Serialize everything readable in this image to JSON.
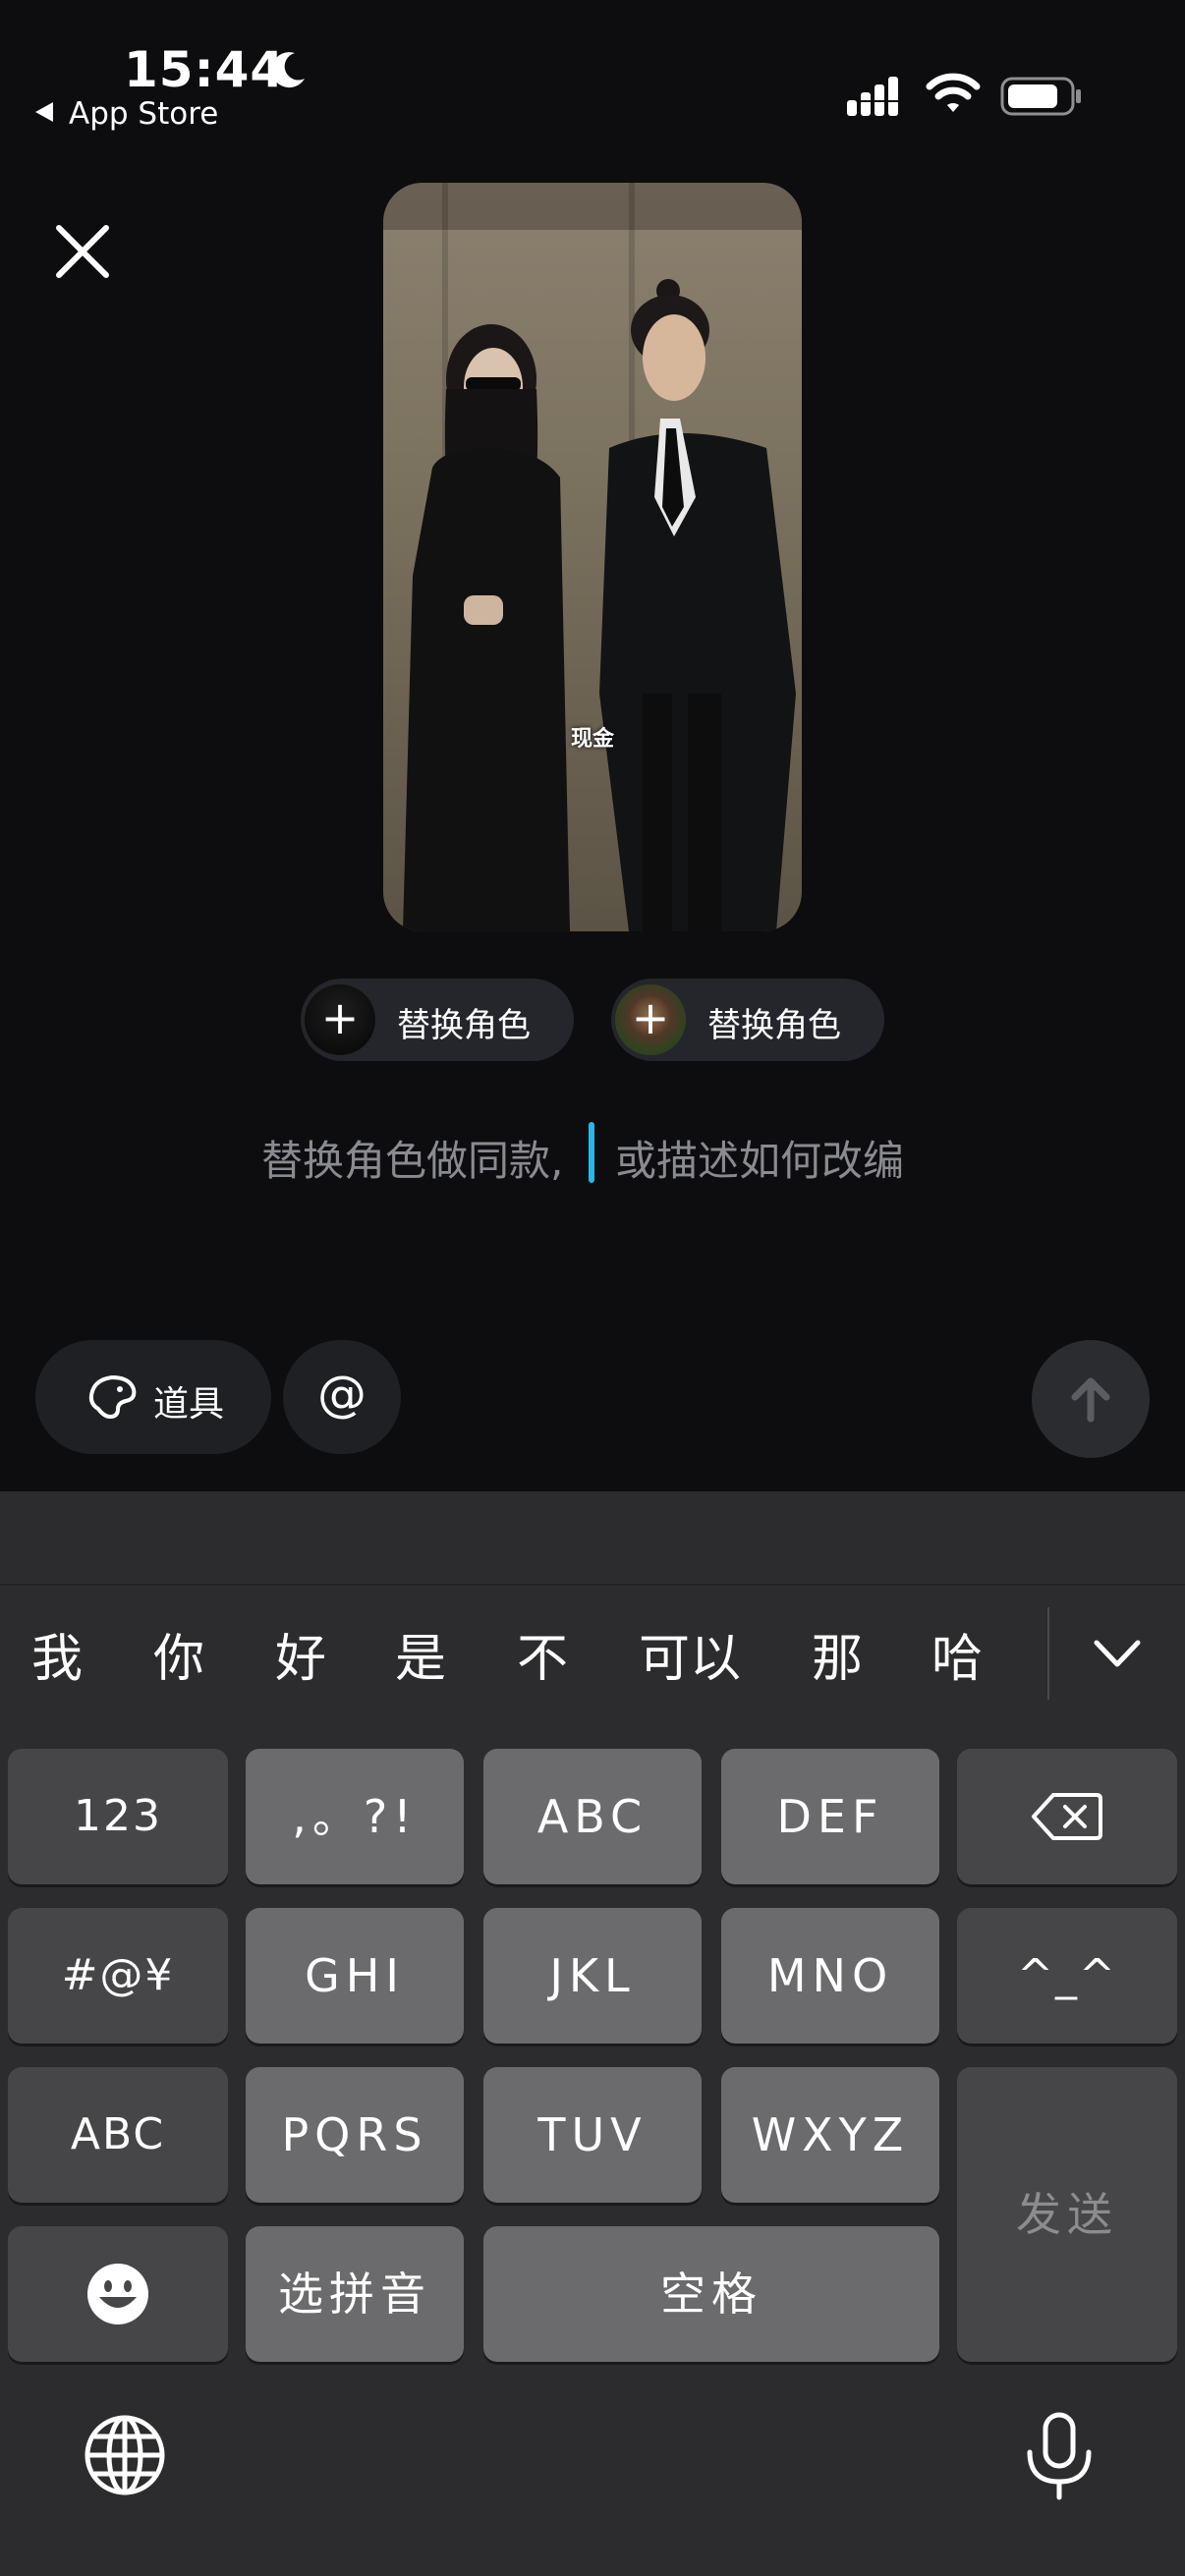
{
  "status_bar": {
    "time": "15:44",
    "back_app": "App Store",
    "icons": [
      "moon-icon",
      "signal-icon",
      "wifi-icon",
      "battery-icon"
    ]
  },
  "close_icon": "close-icon",
  "video": {
    "caption": "现金"
  },
  "replace_chips": [
    {
      "label": "替换角色",
      "plus": "+"
    },
    {
      "label": "替换角色",
      "plus": "+"
    }
  ],
  "prompt": {
    "placeholder_left": "替换角色做同款,",
    "placeholder_right": "或描述如何改编",
    "cursor_color": "#2ab7e8"
  },
  "tools": {
    "props_label": "道具",
    "at_label": "@",
    "send_icon": "arrow-up-icon"
  },
  "keyboard": {
    "candidates": [
      "我",
      "你",
      "好",
      "是",
      "不",
      "可以",
      "那",
      "哈"
    ],
    "rows": {
      "r1": [
        "123",
        ",。?!",
        "ABC",
        "DEF"
      ],
      "r2": [
        "#@¥",
        "GHI",
        "JKL",
        "MNO",
        "^_^"
      ],
      "r3": [
        "ABC",
        "PQRS",
        "TUV",
        "WXYZ"
      ],
      "r4": [
        "选拼音",
        "空格"
      ]
    },
    "send_key": "发送"
  }
}
